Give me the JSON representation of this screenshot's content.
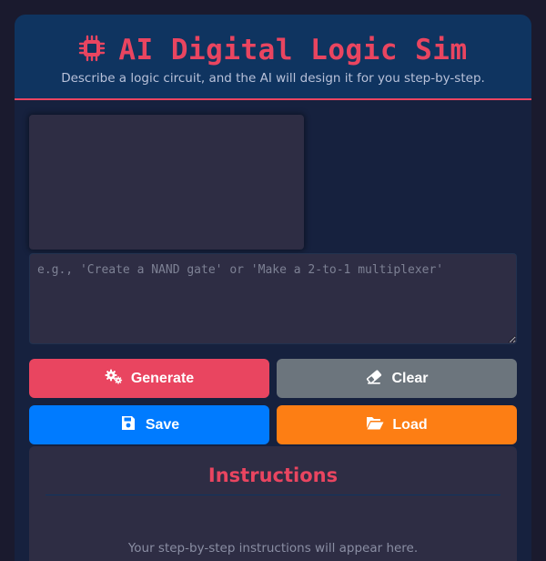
{
  "header": {
    "icon": "microchip-icon",
    "title": "AI Digital Logic Sim",
    "subtitle": "Describe a logic circuit, and the AI will design it for you step-by-step."
  },
  "prompt": {
    "value": "",
    "placeholder": "e.g., 'Create a NAND gate' or 'Make a 2-to-1 multiplexer'"
  },
  "buttons": {
    "generate": {
      "label": "Generate",
      "icon": "gears-icon",
      "color": "#e94560"
    },
    "clear": {
      "label": "Clear",
      "icon": "eraser-icon",
      "color": "#6c757d"
    },
    "save": {
      "label": "Save",
      "icon": "floppy-disk-icon",
      "color": "#007bff"
    },
    "load": {
      "label": "Load",
      "icon": "folder-open-icon",
      "color": "#fd7e14"
    }
  },
  "instructions": {
    "title": "Instructions",
    "placeholder": "Your step-by-step instructions will appear here."
  },
  "colors": {
    "background": "#1a1a2e",
    "panel": "#16213e",
    "header": "#0f3460",
    "accent": "#e94560"
  }
}
